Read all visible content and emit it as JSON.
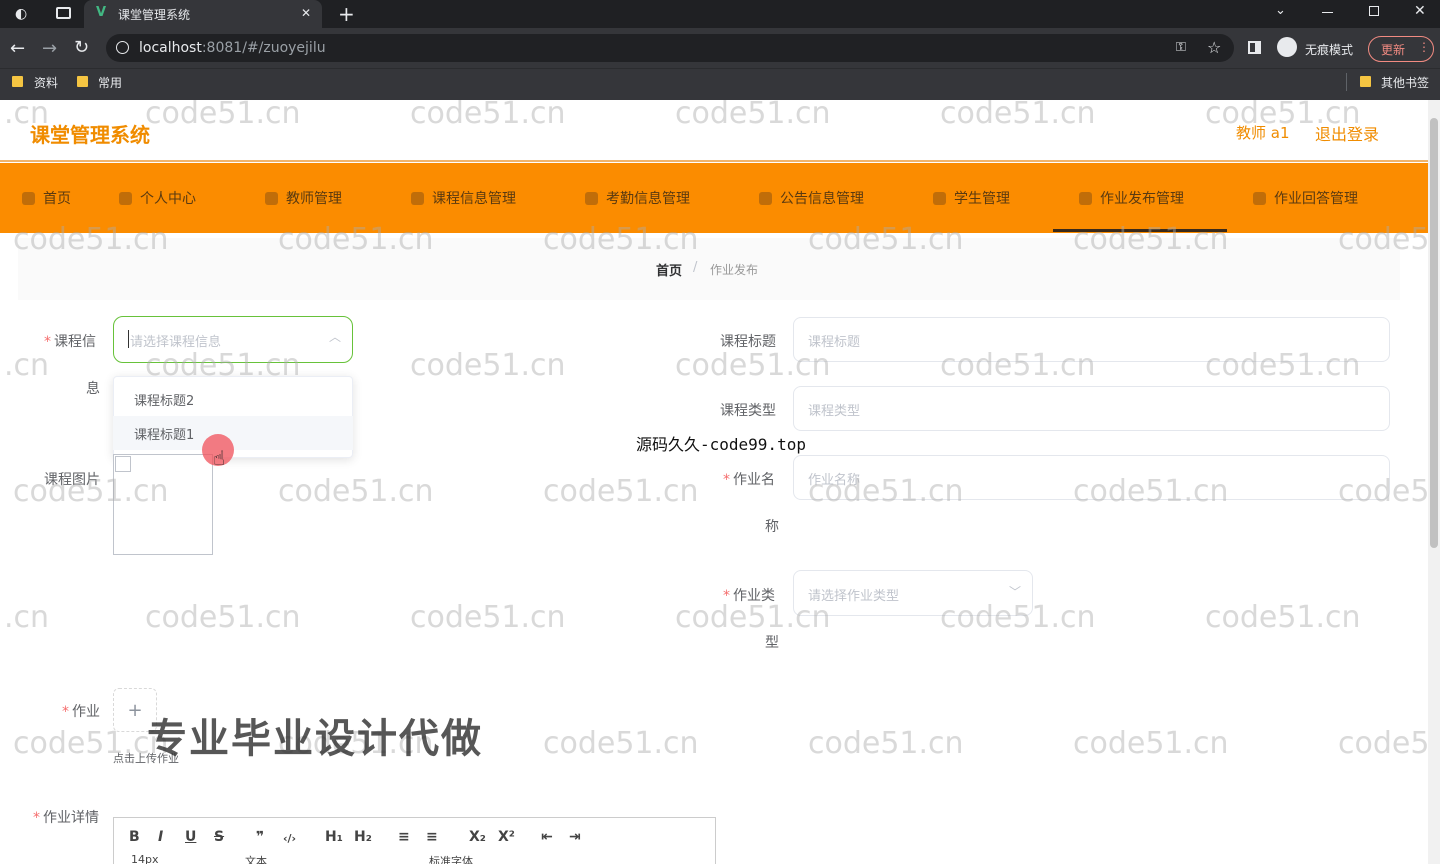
{
  "browser": {
    "tab_title": "课堂管理系统",
    "tab_icon": "V",
    "close_glyph": "✕",
    "new_tab_glyph": "+",
    "url_host": "localhost",
    "url_rest": ":8081/#/zuoyejilu",
    "incognito_label": "无痕模式",
    "update_label": "更新",
    "bookmarks": [
      "资料",
      "常用"
    ],
    "other_bookmarks": "其他书签"
  },
  "header": {
    "title": "课堂管理系统",
    "user": "教师 a1",
    "logout": "退出登录"
  },
  "nav": {
    "items": [
      {
        "label": "首页"
      },
      {
        "label": "个人中心"
      },
      {
        "label": "教师管理"
      },
      {
        "label": "课程信息管理"
      },
      {
        "label": "考勤信息管理"
      },
      {
        "label": "公告信息管理"
      },
      {
        "label": "学生管理"
      },
      {
        "label": "作业发布管理"
      },
      {
        "label": "作业回答管理"
      }
    ],
    "active": "作业发布管理"
  },
  "breadcrumb": {
    "home": "首页",
    "separator": "/",
    "current": "作业发布"
  },
  "form": {
    "course_info_label_a": "课程信",
    "course_info_label_b": "息",
    "course_info_placeholder": "请选择课程信息",
    "course_options": [
      "课程标题2",
      "课程标题1"
    ],
    "course_title_label": "课程标题",
    "course_title_placeholder": "课程标题",
    "course_type_label": "课程类型",
    "course_type_placeholder": "课程类型",
    "course_image_label": "课程图片",
    "homework_name_label_a": "作业名",
    "homework_name_label_b": "称",
    "homework_name_placeholder": "作业名称",
    "homework_type_label_a": "作业类",
    "homework_type_label_b": "型",
    "homework_type_placeholder": "请选择作业类型",
    "homework_label": "作业",
    "upload_hint": "点击上传作业",
    "detail_label": "作业详情",
    "required_mark": "*"
  },
  "editor": {
    "toolbar_row1": [
      "B",
      "I",
      "U",
      "S",
      "❞",
      "‹/›",
      "H₁",
      "H₂",
      "≡",
      "≡",
      "X₂",
      "X²",
      "⇤",
      "⇥"
    ],
    "font_size": "14px",
    "text_label": "文本",
    "font_family": "标准字体"
  },
  "watermarks": {
    "domain": "code51.cn",
    "partial_left": ".cn",
    "partial_right": "code5",
    "overlay_small": "源码久久-code99.top",
    "overlay_big": "专业毕业设计代做"
  }
}
